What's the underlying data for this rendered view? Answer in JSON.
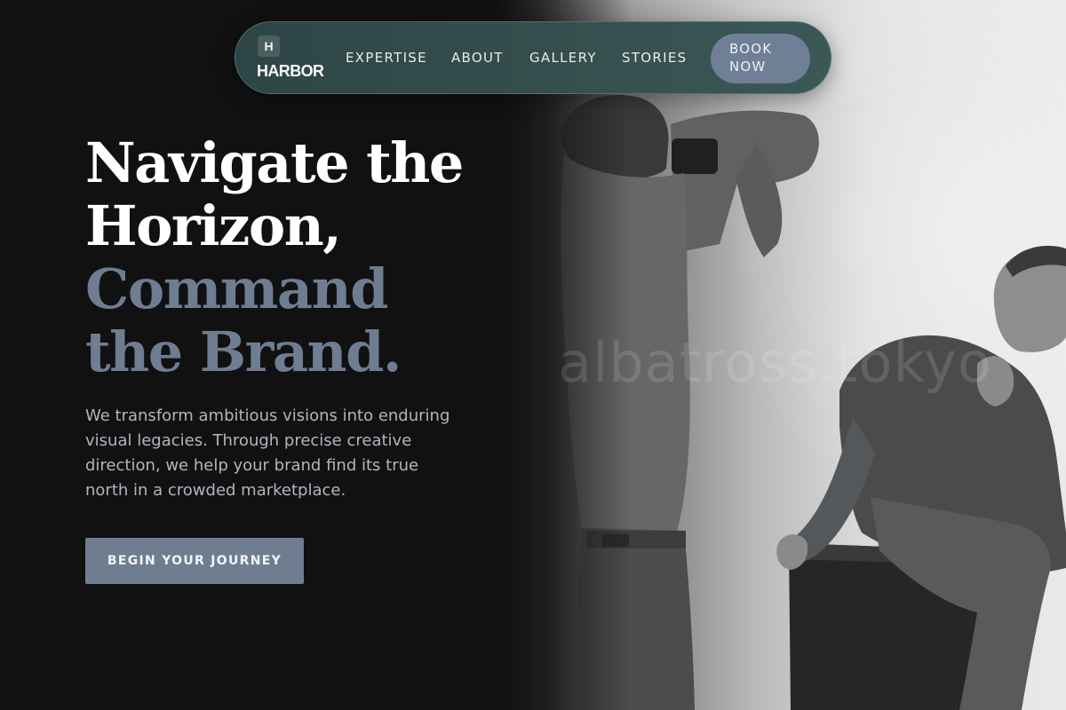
{
  "brand": {
    "mark": "H",
    "name": "HARBOR"
  },
  "nav": {
    "links": [
      {
        "label": "EXPERTISE"
      },
      {
        "label": "ABOUT"
      },
      {
        "label": "GALLERY"
      },
      {
        "label": "STORIES"
      }
    ],
    "cta_line1": "BOOK",
    "cta_line2": "NOW"
  },
  "hero": {
    "headline_lines": [
      "Navigate the",
      "Horizon,",
      "Command",
      "the Brand."
    ],
    "description": "We transform ambitious visions into enduring visual legacies. Through precise creative direction, we help your brand find its true north in a crowded marketplace.",
    "cta_label": "BEGIN YOUR JOURNEY"
  },
  "photo": {
    "watermark": "albatross.tokyo"
  },
  "colors": {
    "background": "#111112",
    "nav_pill": "#344d4c",
    "accent_slate": "#6f7d91",
    "headline_light": "#ffffff"
  }
}
